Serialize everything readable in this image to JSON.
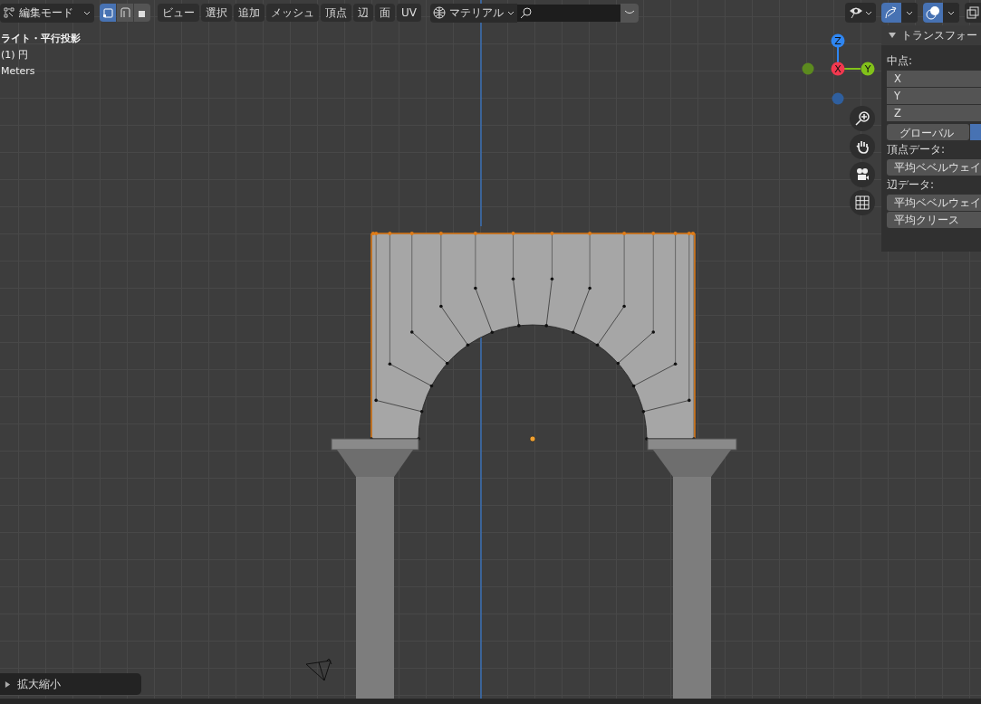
{
  "header": {
    "mode": "編集モード",
    "select_modes": [
      {
        "kind": "vertex",
        "selected": true
      },
      {
        "kind": "edge",
        "selected": false
      },
      {
        "kind": "face",
        "selected": false
      }
    ],
    "menus": [
      "ビュー",
      "選択",
      "追加",
      "メッシュ",
      "頂点",
      "辺",
      "面",
      "UV"
    ],
    "shading": "マテリアル",
    "toggles": [
      {
        "kind": "gizmo",
        "on": true
      },
      {
        "kind": "overlay",
        "on": true
      }
    ]
  },
  "overlay_text": [
    "ライト・平行投影",
    "(1) 円",
    "Meters"
  ],
  "gizmo": {
    "labels": [
      "Z",
      "X",
      "Y"
    ]
  },
  "sidebar": {
    "title": "トランスフォー",
    "expanded": true,
    "median_label": "中点:",
    "median_fields": [
      "X",
      "Y",
      "Z"
    ],
    "space": "グローバル",
    "vertex_label": "頂点データ:",
    "vertex_fields": [
      "平均ベベルウェイ"
    ],
    "edge_label": "辺データ:",
    "edge_fields": [
      "平均ベベルウェイ",
      "平均クリース"
    ]
  },
  "last_operator": {
    "label": "拡大縮小",
    "expanded": false
  }
}
